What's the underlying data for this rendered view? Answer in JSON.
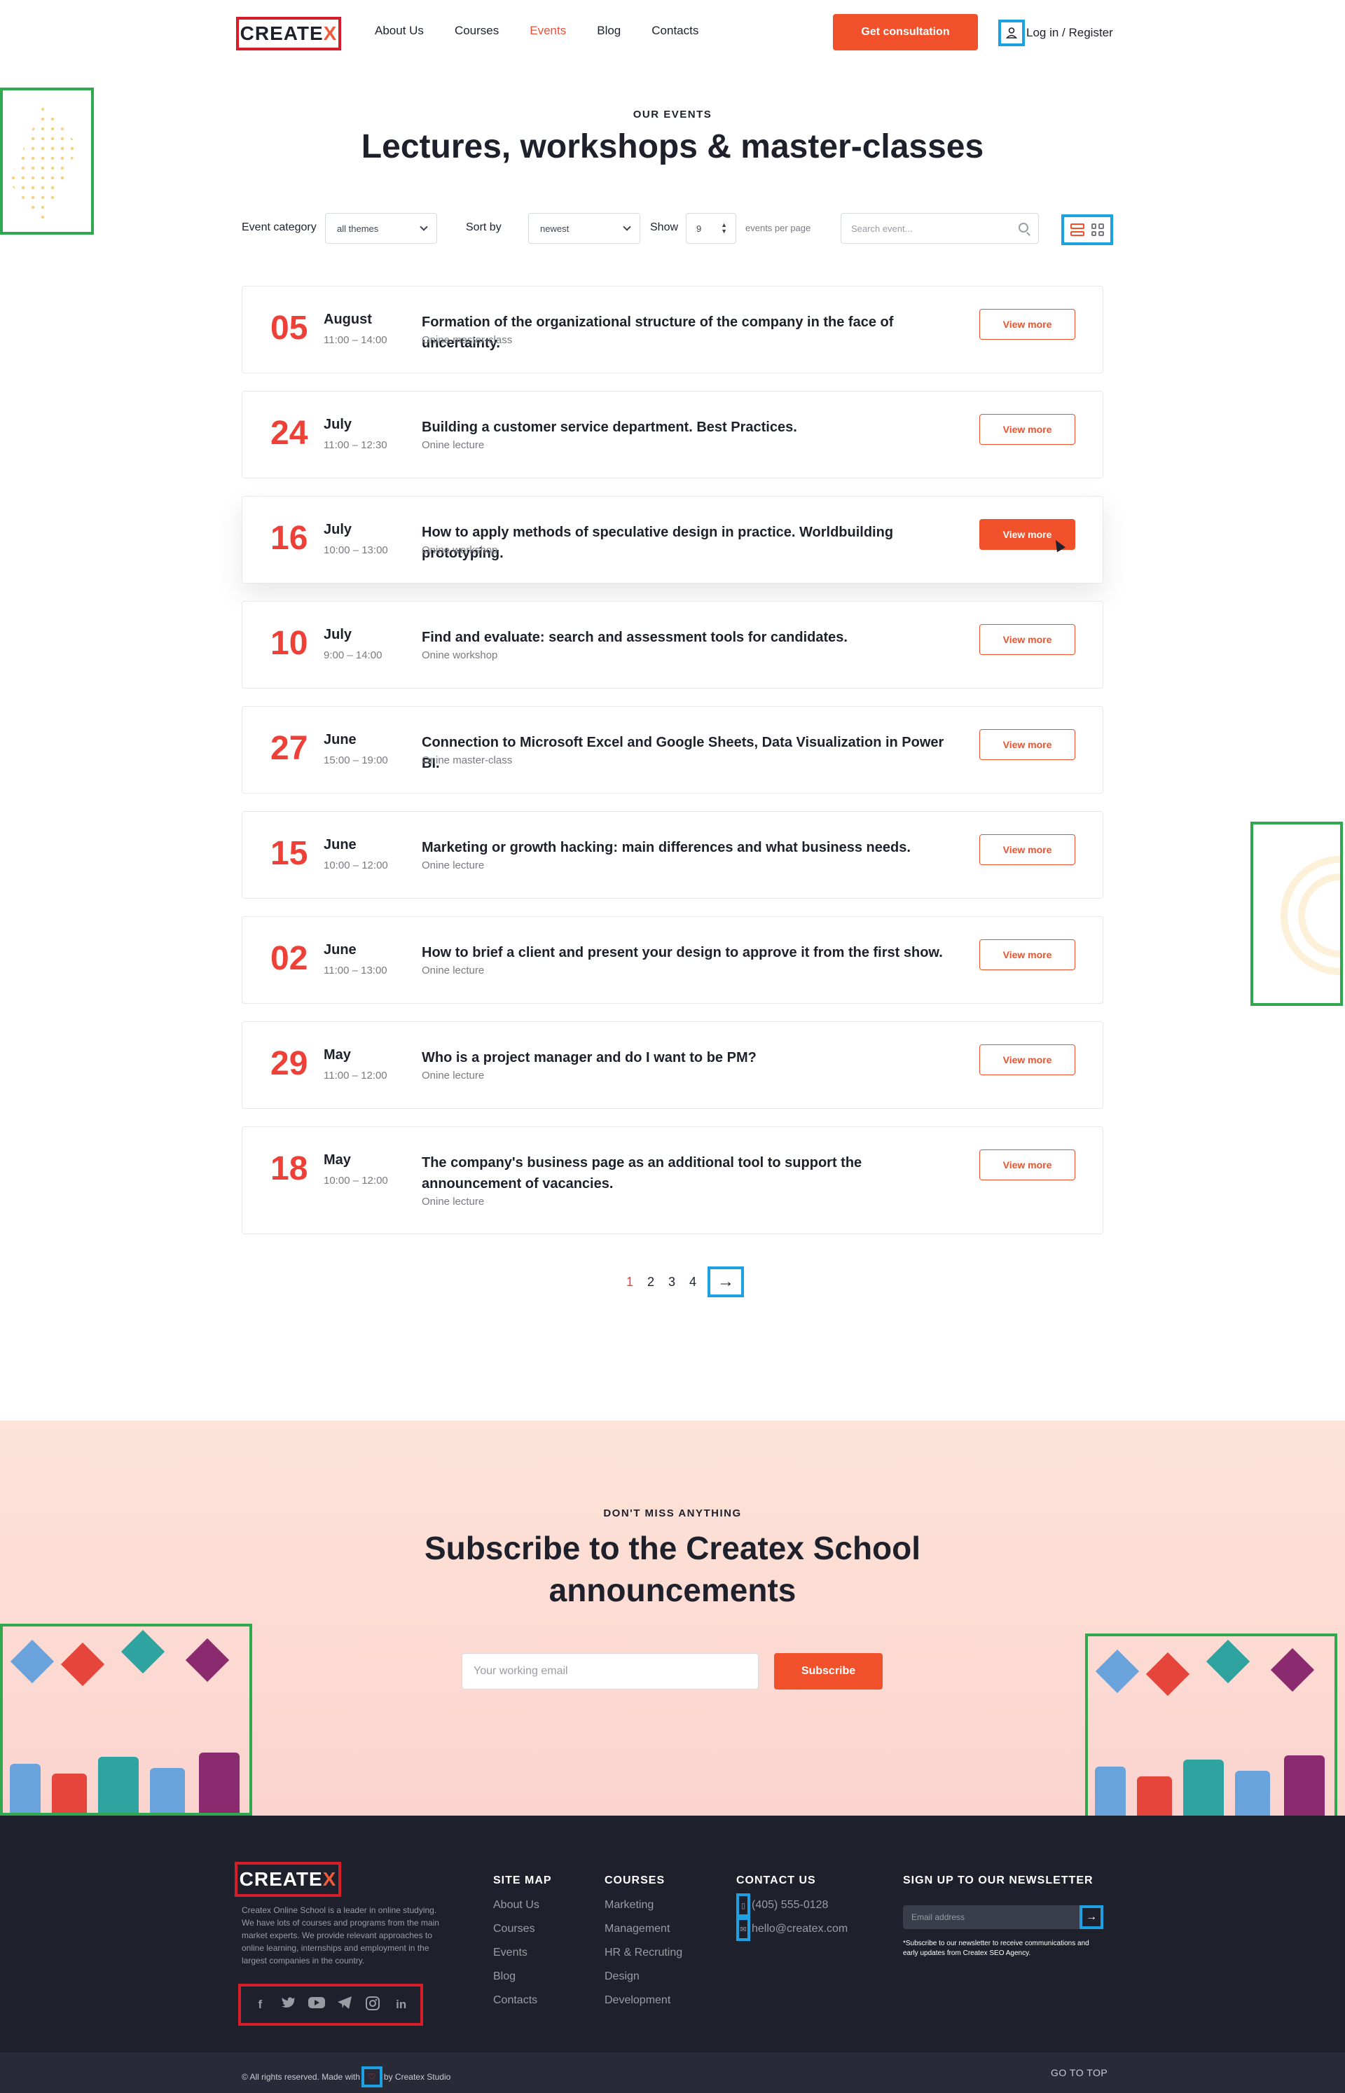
{
  "header": {
    "logo_main": "CREATE",
    "logo_x": "X",
    "nav": [
      "About Us",
      "Courses",
      "Events",
      "Blog",
      "Contacts"
    ],
    "active_nav": "Events",
    "consult_label": "Get consultation",
    "login_label": "Log in / Register"
  },
  "hero": {
    "eyebrow": "OUR EVENTS",
    "title": "Lectures, workshops & master-classes"
  },
  "filters": {
    "category_label": "Event category",
    "category_value": "all themes",
    "sort_label": "Sort by",
    "sort_value": "newest",
    "show_label": "Show",
    "show_value": "9",
    "per_page_label": "events per page",
    "search_placeholder": "Search event..."
  },
  "events": [
    {
      "day": "05",
      "month": "August",
      "time": "11:00 – 14:00",
      "title": "Formation of the organizational structure of the company in the face of uncertainty.",
      "type": "Onine master-class",
      "button": "View more"
    },
    {
      "day": "24",
      "month": "July",
      "time": "11:00 – 12:30",
      "title": "Building a customer service department. Best Practices.",
      "type": "Onine lecture",
      "button": "View more"
    },
    {
      "day": "16",
      "month": "July",
      "time": "10:00 – 13:00",
      "title": "How to apply methods of speculative design in practice. Worldbuilding prototyping.",
      "type": "Onine workshop",
      "button": "View more"
    },
    {
      "day": "10",
      "month": "July",
      "time": "9:00 – 14:00",
      "title": "Find and evaluate: search and assessment tools for candidates.",
      "type": "Onine workshop",
      "button": "View more"
    },
    {
      "day": "27",
      "month": "June",
      "time": "15:00 – 19:00",
      "title": "Connection to Microsoft Excel and Google Sheets, Data Visualization in Power BI.",
      "type": "Onine master-class",
      "button": "View more"
    },
    {
      "day": "15",
      "month": "June",
      "time": "10:00 – 12:00",
      "title": "Marketing or growth hacking: main differences and what business needs.",
      "type": "Onine lecture",
      "button": "View more"
    },
    {
      "day": "02",
      "month": "June",
      "time": "11:00 – 13:00",
      "title": "How to brief a client and present your design to approve it from the first show.",
      "type": "Onine lecture",
      "button": "View more"
    },
    {
      "day": "29",
      "month": "May",
      "time": "11:00 – 12:00",
      "title": "Who is a project manager and do I want to be PM?",
      "type": "Onine lecture",
      "button": "View more"
    },
    {
      "day": "18",
      "month": "May",
      "time": "10:00 – 12:00",
      "title": "The company's business page as an additional tool to support the announcement of vacancies.",
      "type": "Onine lecture",
      "button": "View more"
    }
  ],
  "pagination": {
    "pages": [
      "1",
      "2",
      "3",
      "4"
    ],
    "active_page": "1",
    "next_glyph": "→"
  },
  "subscribe": {
    "eyebrow": "DON'T MISS ANYTHING",
    "title_line1": "Subscribe to the Createx School",
    "title_line2": "announcements",
    "input_placeholder": "Your working email",
    "button": "Subscribe"
  },
  "footer": {
    "logo_main": "CREATE",
    "logo_x": "X",
    "description": "Createx Online School is a leader in online studying. We have lots of courses and programs from the main market experts. We provide relevant approaches to online learning, internships and employment in the largest companies in the country.",
    "socials": [
      "facebook-icon",
      "twitter-icon",
      "youtube-icon",
      "telegram-icon",
      "instagram-icon",
      "linkedin-icon"
    ],
    "sitemap_heading": "SITE MAP",
    "sitemap": [
      "About Us",
      "Courses",
      "Events",
      "Blog",
      "Contacts"
    ],
    "courses_heading": "COURSES",
    "courses": [
      "Marketing",
      "Management",
      "HR & Recruting",
      "Design",
      "Development"
    ],
    "contact_heading": "CONTACT US",
    "phone": "(405) 555-0128",
    "email": "hello@createx.com",
    "newsletter_heading": "SIGN UP TO OUR NEWSLETTER",
    "newsletter_placeholder": "Email address",
    "newsletter_note": "*Subscribe to our newsletter to receive communications and early updates from Createx SEO Agency.",
    "copyright_prefix": "© All rights reserved. Made with",
    "copyright_suffix": "by Createx Studio",
    "go_top": "GO TO TOP"
  },
  "colors": {
    "accent": "#f0512a",
    "accent_date": "#ef4038",
    "dark": "#1e212c",
    "subscribe_bg": "#fde3d8"
  }
}
